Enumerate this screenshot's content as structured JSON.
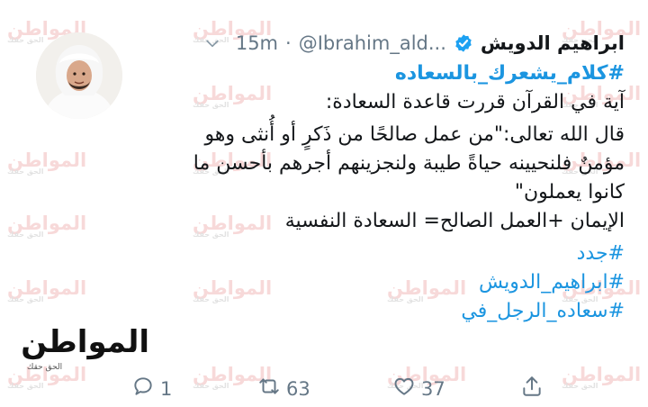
{
  "tweet": {
    "display_name": "ابراهيم الدويش",
    "handle": "@Ibrahim_ald...",
    "separator": "·",
    "time": "15m",
    "hashtag_title": "#كلام_يشعرك_بالسعاده",
    "lines": [
      "آية في القرآن قررت قاعدة السعادة:",
      "قال الله تعالى:\"من عمل صالحًا من ذَكرٍ أو أُنثى وهو",
      "مؤمنٌ فلنحيينه حياةً طيبة ولنجزينهم أجرهم بأحسن ما",
      "كانوا يعملون\"",
      "الإيمان +العمل الصالح= السعادة النفسية"
    ],
    "tags": [
      "#جدد",
      "#ابراهيم_الدويش",
      "#سعاده_الرجل_في"
    ]
  },
  "actions": {
    "reply_count": "1",
    "retweet_count": "63",
    "like_count": "37"
  },
  "watermark": {
    "text": "المواطن",
    "subtext": "الحق حقك"
  },
  "colors": {
    "link": "#1b95e0",
    "muted": "#657786",
    "verified": "#1da1f2",
    "watermark": "#e67a7a",
    "logo_accent": "#d01c1c"
  },
  "icons": {
    "verified": "verified-badge-icon",
    "caret": "chevron-down-icon",
    "reply": "reply-icon",
    "retweet": "retweet-icon",
    "like": "heart-icon",
    "share": "share-icon"
  }
}
